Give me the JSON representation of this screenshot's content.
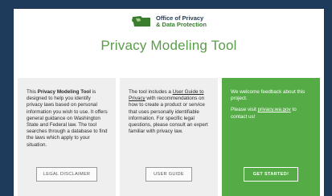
{
  "logo": {
    "line1": "Office of Privacy",
    "line2": "& Data Protection"
  },
  "page_title": "Privacy Modeling Tool",
  "column1": {
    "text_pre": "This ",
    "text_bold": "Privacy Modeling Tool",
    "text_post": " is designed to help you identify privacy laws based on personal information you wish to use. It offers general guidance on Washington State and Federal law. The tool searches through a database to find the laws which apply to your situation.",
    "button": "LEGAL DISCLAIMER"
  },
  "column2": {
    "text_pre": "The tool includes a ",
    "text_link": "User Guide to Privacy",
    "text_post": " with recommendations on how to create a product or service that uses personally identifiable information. For specific legal questions, please consult an expert familiar with privacy law.",
    "button": "USER GUIDE"
  },
  "column3": {
    "p1": "We welcome feedback about this project.",
    "p2_pre": "Please visit ",
    "p2_link": "privacy.wa.gov",
    "p2_post": " to contact us!",
    "button": "GET STARTED!"
  },
  "colors": {
    "green": "#55ac47",
    "navy": "#1f3b5c",
    "title_green": "#5a9c49"
  }
}
